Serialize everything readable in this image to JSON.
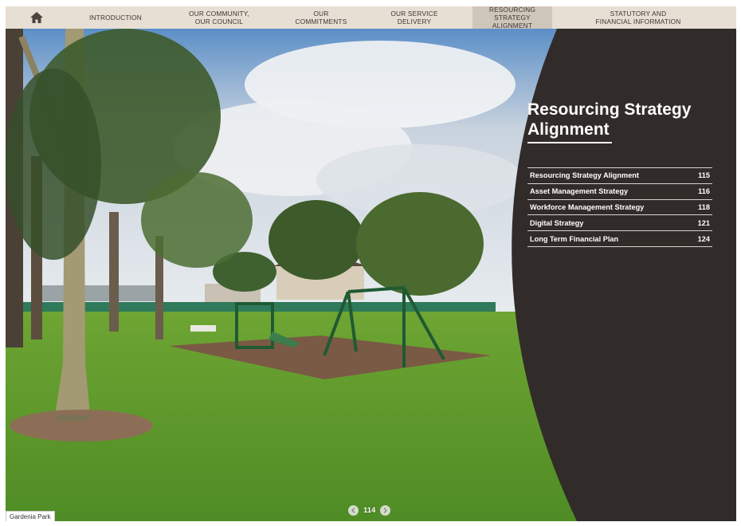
{
  "nav": {
    "home_icon": "home-icon",
    "items": [
      {
        "label": "INTRODUCTION",
        "active": false
      },
      {
        "label": "OUR COMMUNITY,\nOUR COUNCIL",
        "active": false
      },
      {
        "label": "OUR\nCOMMITMENTS",
        "active": false
      },
      {
        "label": "OUR SERVICE\nDELIVERY",
        "active": false
      },
      {
        "label": "RESOURCING\nSTRATEGY ALIGNMENT",
        "active": true
      },
      {
        "label": "STATUTORY AND\nFINANCIAL INFORMATION",
        "active": false
      }
    ]
  },
  "panel": {
    "title": "Resourcing Strategy\nAlignment",
    "toc": [
      {
        "label": "Resourcing Strategy Alignment",
        "page": "115"
      },
      {
        "label": "Asset Management Strategy",
        "page": "116"
      },
      {
        "label": "Workforce Management Strategy",
        "page": "118"
      },
      {
        "label": "Digital Strategy",
        "page": "121"
      },
      {
        "label": "Long Term Financial Plan",
        "page": "124"
      }
    ]
  },
  "photo": {
    "caption": "Gardenia Park"
  },
  "pager": {
    "page": "114",
    "prev_icon": "chevron-left-icon",
    "next_icon": "chevron-right-icon"
  },
  "colors": {
    "nav_bg": "#e7dfd3",
    "nav_active": "#cfc6ba",
    "panel_bg": "#312b29",
    "grass": "#5d9a2c"
  }
}
